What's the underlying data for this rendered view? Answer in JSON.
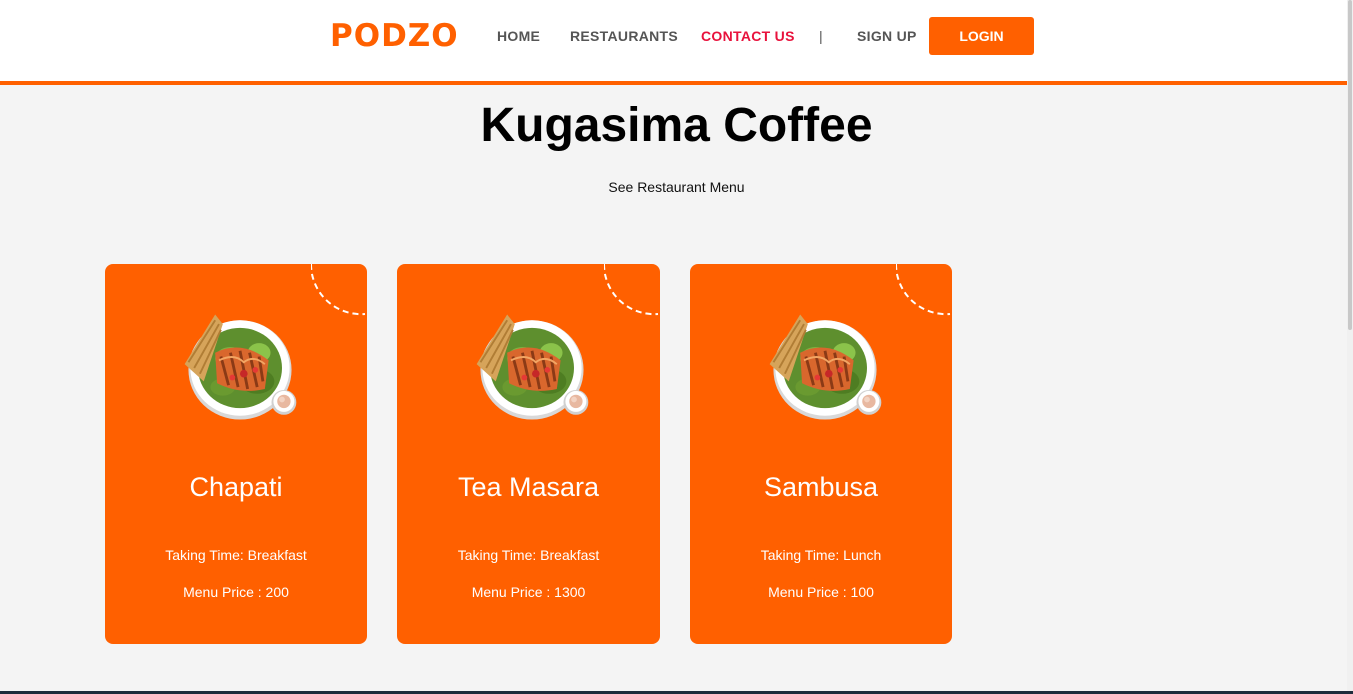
{
  "brand": {
    "logo": "PODZO",
    "accent": "#ff6000",
    "active_link_color": "#e8123c"
  },
  "nav": {
    "home": "HOME",
    "restaurants": "RESTAURANTS",
    "contact": "CONTACT US",
    "separator": "|",
    "signup": "SIGN UP",
    "login": "LOGIN"
  },
  "restaurant": {
    "title": "Kugasima Coffee",
    "menu_link": "See Restaurant Menu"
  },
  "menu_items": [
    {
      "name": "Chapati",
      "time": "Taking Time: Breakfast",
      "price": "Menu Price : 200",
      "icon": "salad-plate-icon"
    },
    {
      "name": "Tea Masara",
      "time": "Taking Time: Breakfast",
      "price": "Menu Price : 1300",
      "icon": "salad-plate-icon"
    },
    {
      "name": "Sambusa",
      "time": "Taking Time: Lunch",
      "price": "Menu Price : 100",
      "icon": "salad-plate-icon"
    }
  ]
}
